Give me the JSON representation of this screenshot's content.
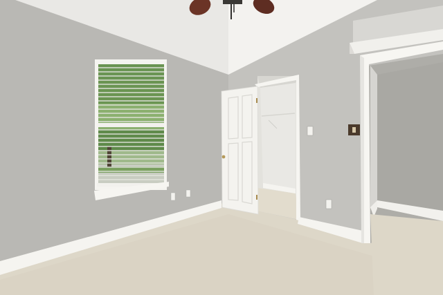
{
  "scene": {
    "kind": "empty-bedroom-photo",
    "colors": {
      "wall_left": "#b9b8b4",
      "wall_right": "#c3c2be",
      "ceiling": "#ecebe8",
      "carpet": "#ddd7c8",
      "trim": "#f7f6f2",
      "door": "#f4f3ef",
      "fan_blade": "#6b3426",
      "foliage": "#6f9a52",
      "closet_wall": "#e3e2dd"
    },
    "objects": [
      "ceiling-fan",
      "window-with-blinds",
      "open-closet-door",
      "walk-in-closet",
      "light-switch",
      "dimmer-switch",
      "wall-outlets",
      "doorway-to-hall",
      "carpet-floor",
      "baseboards",
      "wall-shelf"
    ]
  }
}
